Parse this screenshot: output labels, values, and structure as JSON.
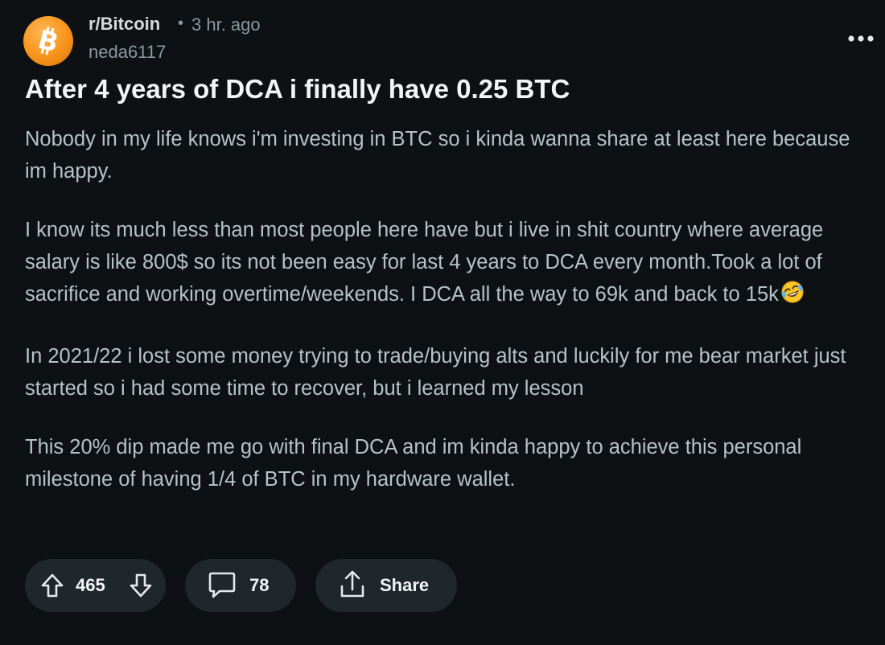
{
  "header": {
    "subreddit": "r/Bitcoin",
    "separator": "•",
    "time_ago": "3 hr. ago",
    "author": "neda6117",
    "avatar_icon": "bitcoin-logo-icon",
    "menu_icon": "more-options-icon"
  },
  "post": {
    "title": "After 4 years of DCA i finally have 0.25 BTC",
    "paragraphs": [
      "Nobody in my life knows i'm investing in BTC so i kinda wanna share at least here because im happy.",
      "I know its much less than most people here have but i live in shit country where average salary is like 800$ so its not been easy for last 4 years to DCA every month.Took a lot of sacrifice and working overtime/weekends. I DCA all the way to 69k and back to 15k",
      "In 2021/22 i lost some money trying to trade/buying alts and luckily for me bear market just started so i had some time to recover, but i learned my lesson",
      "This 20% dip made me go with final DCA and im kinda happy to achieve this personal milestone of having 1/4 of BTC in my hardware wallet."
    ],
    "emoji": "rolling-on-the-floor-laughing-emoji"
  },
  "actions": {
    "upvotes": "465",
    "comments": "78",
    "share_label": "Share"
  },
  "colors": {
    "background": "#0e1113",
    "pill": "#20272b",
    "bitcoin_orange": "#f7931a",
    "title": "#f2f4f5",
    "body": "#b7c2c7",
    "meta": "#8b989e"
  }
}
